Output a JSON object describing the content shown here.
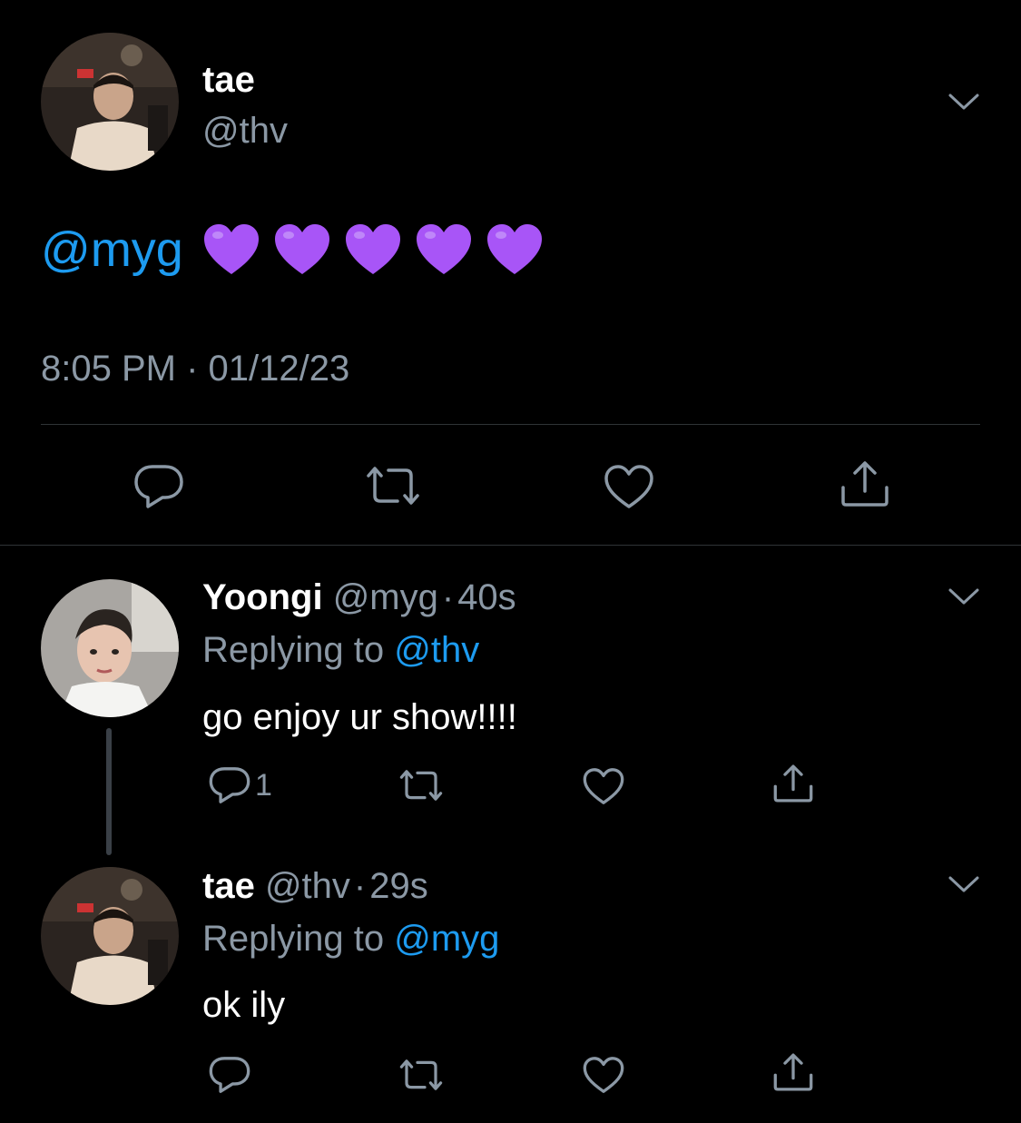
{
  "main_tweet": {
    "name": "tae",
    "handle": "@thv",
    "mention": "@myg",
    "hearts": [
      "purple-heart",
      "purple-heart",
      "purple-heart",
      "purple-heart",
      "purple-heart"
    ],
    "timestamp": "8:05 PM · 01/12/23"
  },
  "replies": [
    {
      "name": "Yoongi",
      "handle": "@myg",
      "sep": "·",
      "time": "40s",
      "replying_prefix": "Replying to",
      "replying_to": "@thv",
      "text": "go enjoy ur show!!!!",
      "reply_count": "1"
    },
    {
      "name": "tae",
      "handle": "@thv",
      "sep": "·",
      "time": "29s",
      "replying_prefix": "Replying to",
      "replying_to": "@myg",
      "text": "ok ily",
      "reply_count": ""
    }
  ],
  "colors": {
    "background": "#000000",
    "link": "#1d9bf0",
    "secondary_text": "#8b98a5",
    "divider": "#2f3336",
    "heart_emoji": "#a855f7"
  },
  "icons": {
    "reply": "reply-icon",
    "retweet": "retweet-icon",
    "like": "like-icon",
    "share": "share-icon",
    "more": "chevron-down-icon"
  }
}
